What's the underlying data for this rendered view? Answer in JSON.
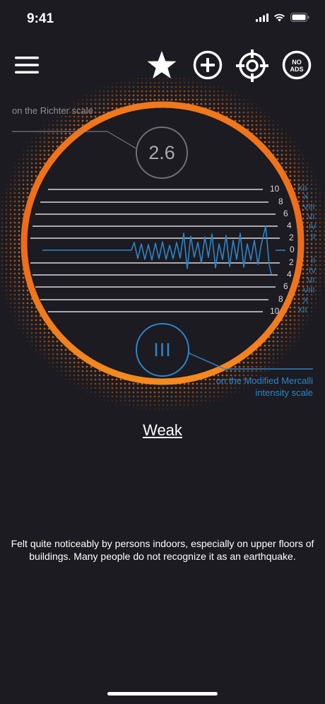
{
  "status_bar": {
    "time": "9:41"
  },
  "toolbar": {
    "menu_icon": "hamburger-menu-icon",
    "favorite_icon": "star-icon",
    "add_icon": "plus-circle-icon",
    "locate_icon": "crosshair-icon",
    "no_ads_label_top": "NO",
    "no_ads_label_bottom": "ADS",
    "no_ads_icon": "no-ads-icon"
  },
  "richter": {
    "caption": "on the Richter scale",
    "value": "2.6"
  },
  "mercalli": {
    "caption": "on the Modified Mercalli intensity scale",
    "value": "III"
  },
  "scale": {
    "numbers_top": [
      "10",
      "8",
      "6",
      "4",
      "2"
    ],
    "zero": "0",
    "numbers_bottom": [
      "2",
      "4",
      "6",
      "8",
      "10"
    ],
    "roman_top": [
      "XII",
      "X",
      "VIII",
      "VI",
      "IV",
      "II"
    ],
    "roman_bottom": [
      "II",
      "IV",
      "VI",
      "VIII",
      "X",
      "XII"
    ]
  },
  "intensity": {
    "label": "Weak"
  },
  "description": {
    "text": "Felt quite noticeably by persons indoors, especially on upper floors of buildings. Many people do not recognize it as an earthquake."
  },
  "colors": {
    "ring_orange": "#f07a1c",
    "accent_blue": "#2f84c8",
    "background": "#1b1b21",
    "gray_badge": "#6f6f76"
  }
}
